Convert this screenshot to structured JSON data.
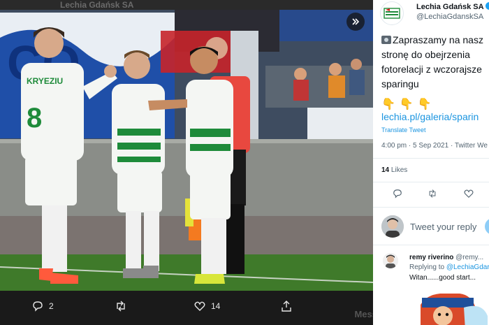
{
  "media": {
    "ghost_account_name": "Lechia Gdańsk SA",
    "expand_icon": "expand-arrows-icon",
    "jersey_text": "KRYEZIU",
    "jersey_number": "8",
    "actions": {
      "reply_count": "2",
      "retweet_count": "",
      "like_count": "14",
      "share_label": ""
    },
    "ghost_messages_label": "Mess"
  },
  "tweet": {
    "account_name": "Lechia Gdańsk SA",
    "handle": "@LechiaGdanskSA",
    "text_lines": [
      "Zapraszamy na nasz",
      "stronę do obejrzenia",
      "fotorelacji z wczorajsze",
      "sparingu"
    ],
    "emoji_text": "👇👇👇",
    "link": "lechia.pl/galeria/sparin",
    "translate": "Translate Tweet",
    "meta": "4:00 pm · 5 Sep 2021 · Twitter We",
    "likes_count": "14",
    "likes_label": "Likes",
    "reply_placeholder": "Tweet your reply"
  },
  "reply": {
    "author_name": "remy riverino",
    "author_handle": "@remy...",
    "replying_prefix": "Replying to",
    "replying_handle": "@LechiaGdar",
    "text": "Witan......good start..."
  },
  "colors": {
    "accent": "#1da1f2",
    "link": "#1b95e0",
    "lechia_green": "#1e8b3a"
  }
}
